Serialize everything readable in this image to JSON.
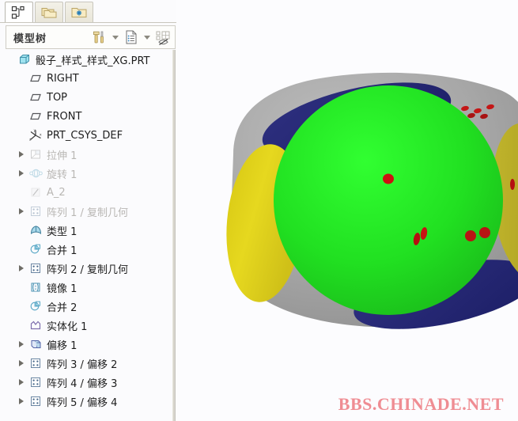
{
  "tabs": [
    {
      "name": "model-tree-tab",
      "icon": "tree-hierarchy-icon",
      "active": true
    },
    {
      "name": "folder-browser-tab",
      "icon": "folders-icon",
      "active": false
    },
    {
      "name": "favorites-folder-tab",
      "icon": "folder-star-icon",
      "active": false
    }
  ],
  "panel": {
    "title": "模型树",
    "tools": [
      {
        "name": "settings-tools-button",
        "icon": "hammer-screwdriver-icon"
      },
      {
        "name": "settings-tools-dropdown",
        "icon": "chevron-down-icon"
      },
      {
        "name": "tree-columns-button",
        "icon": "list-document-icon"
      },
      {
        "name": "tree-columns-dropdown",
        "icon": "chevron-down-icon"
      },
      {
        "name": "tree-filters-button",
        "icon": "tree-filter-icon"
      }
    ]
  },
  "tree": {
    "items": [
      {
        "label": "骰子_样式_样式_XG.PRT",
        "icon": "part-cube-icon",
        "indent": 0,
        "expander": false,
        "dim": false
      },
      {
        "label": "RIGHT",
        "icon": "datum-plane-icon",
        "indent": 1,
        "expander": false,
        "dim": false
      },
      {
        "label": "TOP",
        "icon": "datum-plane-icon",
        "indent": 1,
        "expander": false,
        "dim": false
      },
      {
        "label": "FRONT",
        "icon": "datum-plane-icon",
        "indent": 1,
        "expander": false,
        "dim": false
      },
      {
        "label": "PRT_CSYS_DEF",
        "icon": "coordinate-system-icon",
        "indent": 1,
        "expander": false,
        "dim": false
      },
      {
        "label": "拉伸 1",
        "icon": "extrude-icon",
        "indent": 1,
        "expander": true,
        "dim": true
      },
      {
        "label": "旋转 1",
        "icon": "revolve-icon",
        "indent": 1,
        "expander": true,
        "dim": true
      },
      {
        "label": "A_2",
        "icon": "datum-axis-icon",
        "indent": 1,
        "expander": false,
        "dim": true
      },
      {
        "label": "阵列 1 / 复制几何",
        "icon": "pattern-icon",
        "indent": 1,
        "expander": true,
        "dim": true
      },
      {
        "label": "类型 1",
        "icon": "type-surface-icon",
        "indent": 1,
        "expander": false,
        "dim": false
      },
      {
        "label": "合并 1",
        "icon": "merge-icon",
        "indent": 1,
        "expander": false,
        "dim": false
      },
      {
        "label": "阵列 2 / 复制几何",
        "icon": "pattern-icon",
        "indent": 1,
        "expander": true,
        "dim": false
      },
      {
        "label": "镜像 1",
        "icon": "mirror-icon",
        "indent": 1,
        "expander": false,
        "dim": false
      },
      {
        "label": "合并 2",
        "icon": "merge-icon",
        "indent": 1,
        "expander": false,
        "dim": false
      },
      {
        "label": "实体化 1",
        "icon": "solidify-icon",
        "indent": 1,
        "expander": false,
        "dim": false
      },
      {
        "label": "偏移 1",
        "icon": "offset-icon",
        "indent": 1,
        "expander": true,
        "dim": false
      },
      {
        "label": "阵列 3 / 偏移 2",
        "icon": "pattern-icon",
        "indent": 1,
        "expander": true,
        "dim": false
      },
      {
        "label": "阵列 4 / 偏移 3",
        "icon": "pattern-icon",
        "indent": 1,
        "expander": true,
        "dim": false
      },
      {
        "label": "阵列 5 / 偏移 4",
        "icon": "pattern-icon",
        "indent": 1,
        "expander": true,
        "dim": false
      }
    ]
  },
  "viewport": {
    "model_name": "dice-3d-model",
    "watermark": "BBS.CHINADE.NET",
    "colors": {
      "body_gray": "#a8a8a8",
      "face_green_bright": "#22dd22",
      "face_green_dark": "#3c9e3c",
      "face_yellow": "#e0d21c",
      "face_yellow_dark": "#bfb22a",
      "face_navy": "#282a78",
      "pip_red": "#cc1111",
      "background": "#fcfcfe",
      "watermark_color": "#ef8d93"
    }
  }
}
